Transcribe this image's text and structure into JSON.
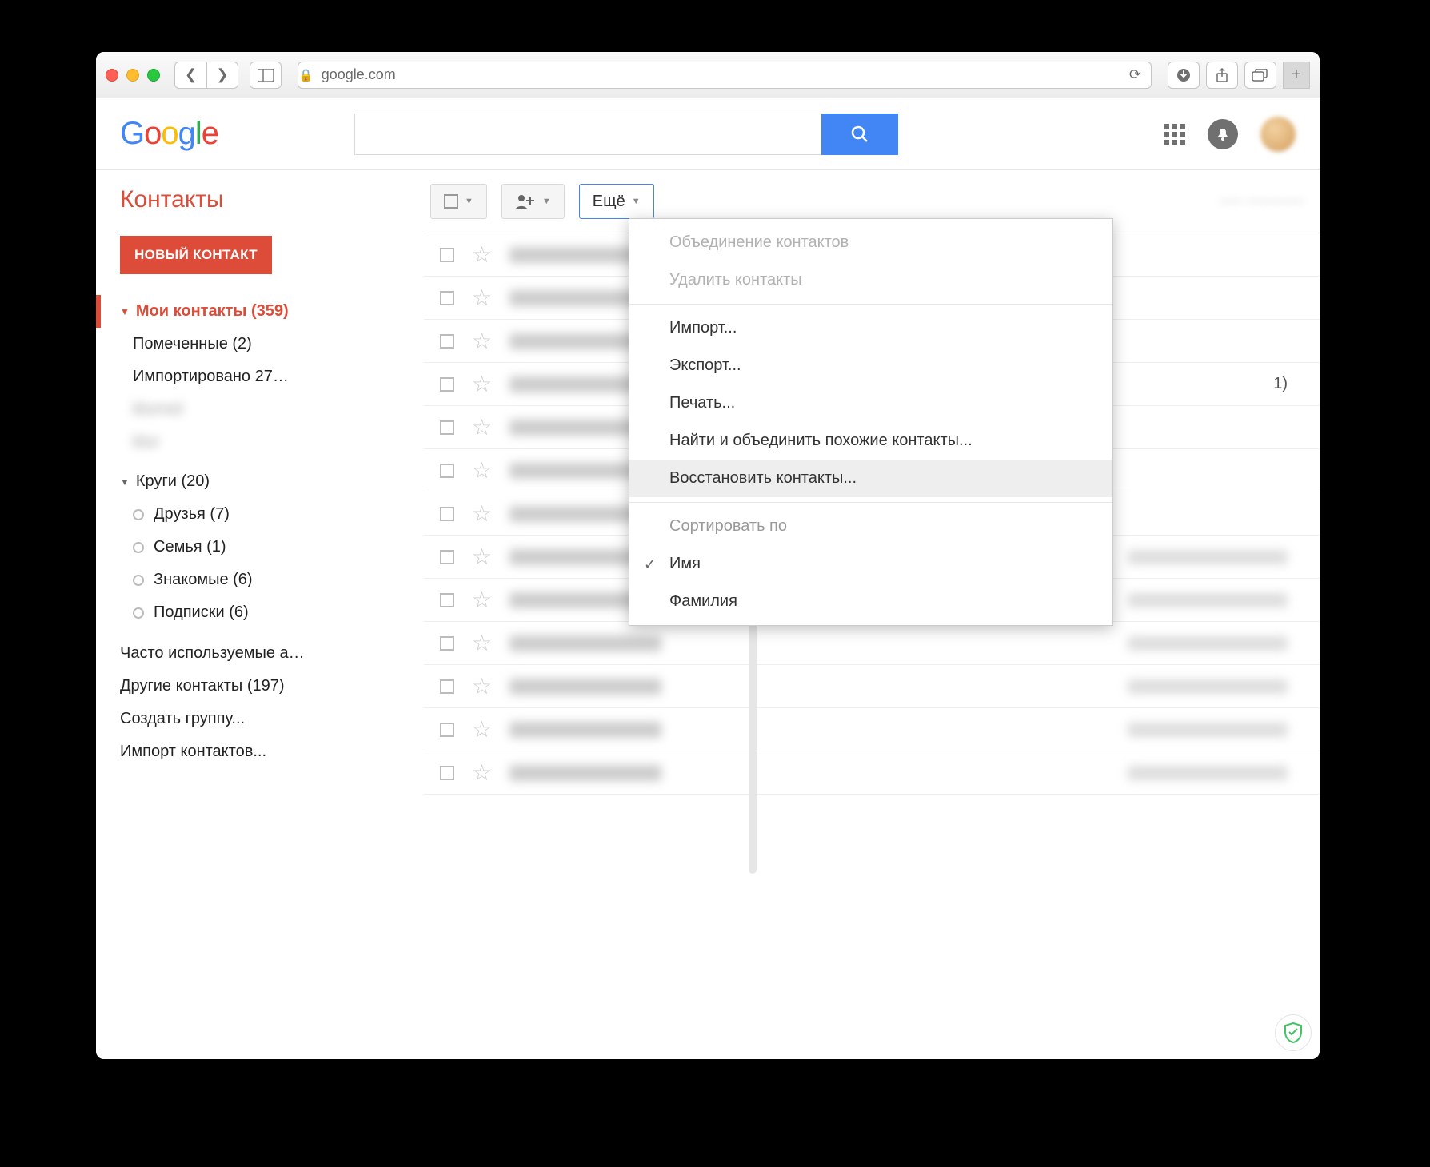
{
  "browser": {
    "url_display": "google.com"
  },
  "header": {
    "logo": "Google",
    "search_placeholder": ""
  },
  "app_title": "Контакты",
  "new_contact_label": "НОВЫЙ КОНТАКТ",
  "sidebar": {
    "my_contacts": "Мои контакты (359)",
    "starred": "Помеченные (2)",
    "imported": "Импортировано 27…",
    "circles_header": "Круги (20)",
    "circles": [
      "Друзья (7)",
      "Семья (1)",
      "Знакомые (6)",
      "Подписки (6)"
    ],
    "frequent": "Часто используемые а…",
    "other": "Другие контакты (197)",
    "create_group": "Создать группу...",
    "import_contacts": "Импорт контактов..."
  },
  "toolbar": {
    "more_label": "Ещё"
  },
  "right_number": "1)",
  "more_menu": {
    "merge": "Объединение контактов",
    "delete": "Удалить контакты",
    "import": "Импорт...",
    "export": "Экспорт...",
    "print": "Печать...",
    "find_merge": "Найти и объединить похожие контакты...",
    "restore": "Восстановить контакты...",
    "sort_by": "Сортировать по",
    "by_name": "Имя",
    "by_surname": "Фамилия"
  }
}
